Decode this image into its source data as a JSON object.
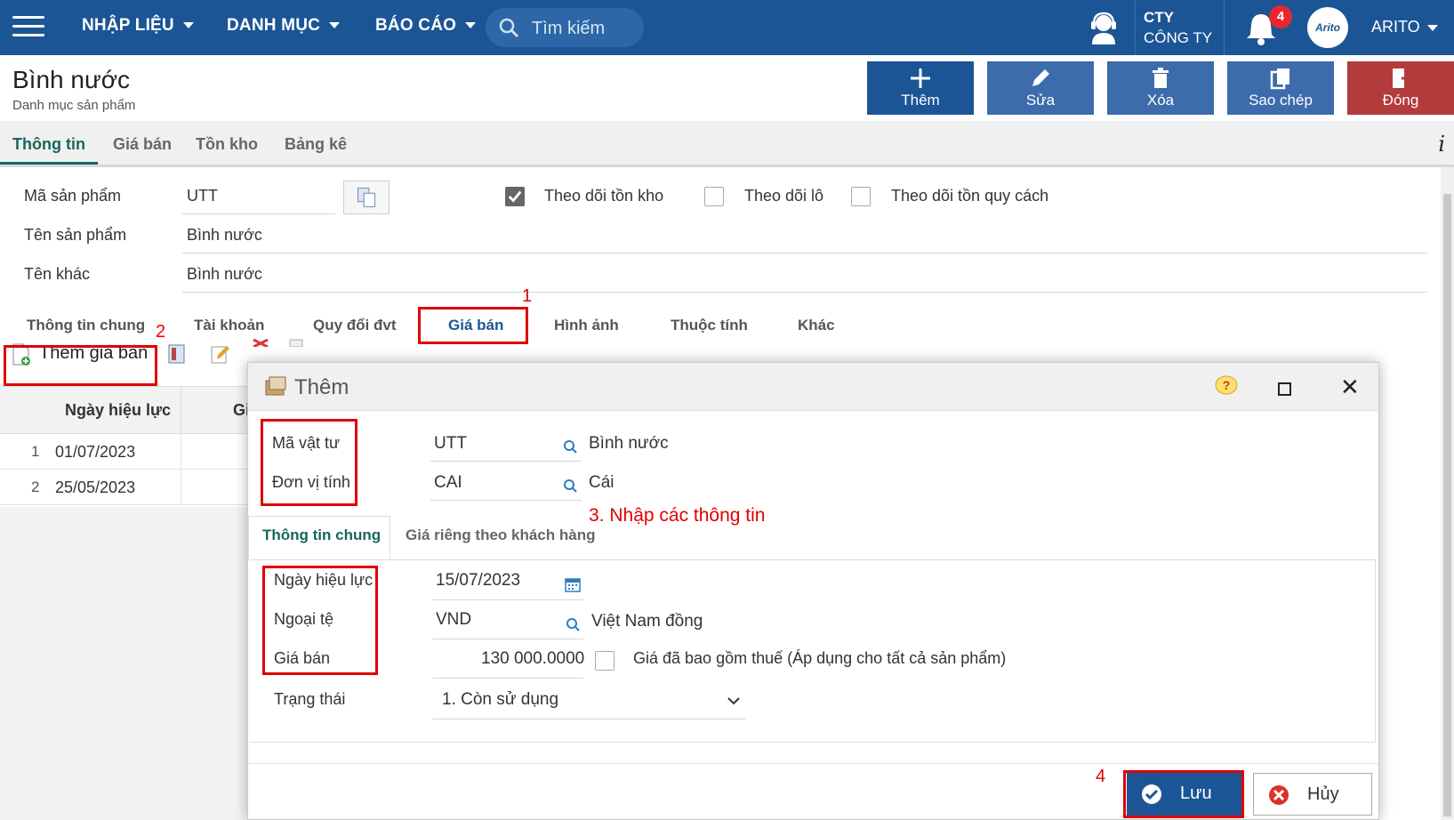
{
  "topbar": {
    "menu": [
      "NHẬP LIỆU",
      "DANH MỤC",
      "BÁO CÁO"
    ],
    "search_placeholder": "Tìm kiếm",
    "company_code": "CTY",
    "company_name": "CÔNG TY",
    "notification_count": "4",
    "avatar_text": "Arito",
    "user": "ARITO"
  },
  "header": {
    "title": "Bình nước",
    "subtitle": "Danh mục sản phẩm",
    "buttons": [
      {
        "label": "Thêm",
        "color": "#1c5595"
      },
      {
        "label": "Sửa",
        "color": "#3c6cab"
      },
      {
        "label": "Xóa",
        "color": "#3c6cab"
      },
      {
        "label": "Sao chép",
        "color": "#3c6cab"
      },
      {
        "label": "Đóng",
        "color": "#b33b3b"
      }
    ]
  },
  "tabs": [
    "Thông tin",
    "Giá bán",
    "Tồn kho",
    "Bảng kê"
  ],
  "info_icon": "i",
  "form": {
    "product_code_label": "Mã sản phẩm",
    "product_code": "UTT",
    "product_name_label": "Tên sản phẩm",
    "product_name": "Bình nước",
    "other_name_label": "Tên khác",
    "other_name": "Bình nước",
    "checkboxes": [
      {
        "label": "Theo dõi tồn kho",
        "checked": true
      },
      {
        "label": "Theo dõi lô",
        "checked": false
      },
      {
        "label": "Theo dõi tồn quy cách",
        "checked": false
      }
    ]
  },
  "subtabs": [
    "Thông tin chung",
    "Tài khoản",
    "Quy đổi đvt",
    "Giá bán",
    "Hình ảnh",
    "Thuộc tính",
    "Khác"
  ],
  "grid_toolbar": {
    "add_price_label": "Thêm giá bán"
  },
  "grid": {
    "columns": [
      "Ngày hiệu lực",
      "Gi"
    ],
    "rows": [
      {
        "n": "1",
        "date": "01/07/2023"
      },
      {
        "n": "2",
        "date": "25/05/2023"
      }
    ]
  },
  "dialog": {
    "title": "Thêm",
    "item_code_label": "Mã vật tư",
    "item_code": "UTT",
    "item_name": "Bình nước",
    "unit_label": "Đơn vị tính",
    "unit_code": "CAI",
    "unit_name": "Cái",
    "tabs": [
      "Thông tin chung",
      "Giá riêng theo khách hàng"
    ],
    "effective_date_label": "Ngày hiệu lực",
    "effective_date": "15/07/2023",
    "currency_label": "Ngoại tệ",
    "currency_code": "VND",
    "currency_name": "Việt Nam đồng",
    "price_label": "Giá bán",
    "price": "130 000.0000",
    "tax_included_label": "Giá đã bao gồm thuế (Áp dụng cho tất cả sản phẩm)",
    "status_label": "Trạng thái",
    "status_value": "1. Còn sử dụng",
    "save_label": "Lưu",
    "cancel_label": "Hủy"
  },
  "annotations": {
    "n1": "1",
    "n2": "2",
    "step3": "3. Nhập các thông tin",
    "n4": "4"
  }
}
